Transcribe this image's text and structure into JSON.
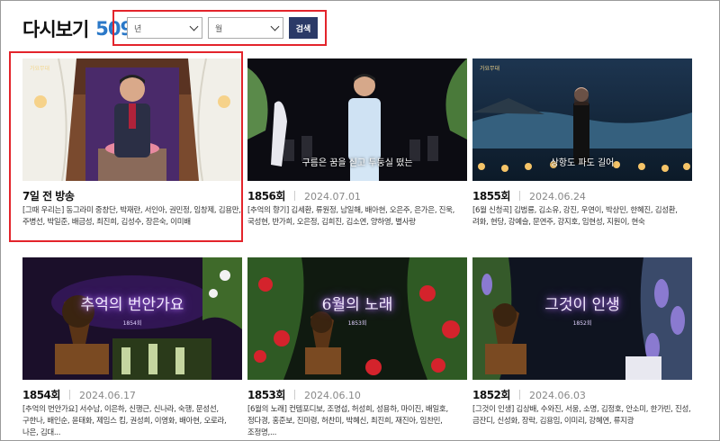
{
  "header": {
    "title": "다시보기",
    "count": "509"
  },
  "filters": {
    "year_placeholder": "년",
    "month_placeholder": "월",
    "search_label": "검색"
  },
  "episodes": [
    {
      "num": "7일 전 방송",
      "date": "",
      "cast": "[그때 우리는] 동그라미 중창단, 박재란, 서인아, 권민정, 임창제, 김용만, 주병선, 박일준, 배금성, 최진희, 김성수, 장은숙, 이미배",
      "caption": "",
      "show_title": "",
      "show_sub": "",
      "logo": "가요무대"
    },
    {
      "num": "1856회",
      "date": "2024.07.01",
      "cast": "[추억의 향기] 김세환, 류원정, 남일해, 배아현, 오은주, 은가은, 진욱, 국성현, 반가희, 오은정, 김희진, 김소연, 양하영, 별사랑",
      "caption": "구름은 꿈을 싣고 두둥실 떴는",
      "show_title": "",
      "show_sub": "",
      "logo": ""
    },
    {
      "num": "1855회",
      "date": "2024.06.24",
      "cast": "[6월 신청곡] 김범룡, 김소유, 강진, 우연이, 박상민, 한혜진, 김성환, 려화, 현당, 강예슬, 문연주, 강지호, 임현성, 지원이, 현숙",
      "caption": "상항도 파도 길어",
      "show_title": "",
      "show_sub": "",
      "logo": "가요무대"
    },
    {
      "num": "1854회",
      "date": "2024.06.17",
      "cast": "[추억의 번안가요] 서수남, 이은하, 신행근, 신나라, 숙행, 문성선, 구한나, 배인순, 윤태화, 제임스 킴, 권성희, 이영화, 배아현, 오로라, 나은, 김대...",
      "caption": "",
      "show_title": "추억의 번안가요",
      "show_sub": "1854회",
      "logo": ""
    },
    {
      "num": "1853회",
      "date": "2024.06.10",
      "cast": "[6월의 노래] 컨템포디보, 조명섭, 허성희, 성용하, 마이진, 배일호, 정다경, 홍준보, 진미령, 허찬미, 박혜신, 최진희, 재진아, 임찬민, 조정명,...",
      "caption": "",
      "show_title": "6월의 노래",
      "show_sub": "1853회",
      "logo": ""
    },
    {
      "num": "1852회",
      "date": "2024.06.03",
      "cast": "[그것이 인생] 김상배, 수와진, 서웅, 소명, 김정호, 안소미, 한가빈, 진성, 금잔디, 신성화, 장락, 김용임, 이미리, 강혜연, 류지광",
      "caption": "",
      "show_title": "그것이 인생",
      "show_sub": "1852회",
      "logo": ""
    }
  ]
}
